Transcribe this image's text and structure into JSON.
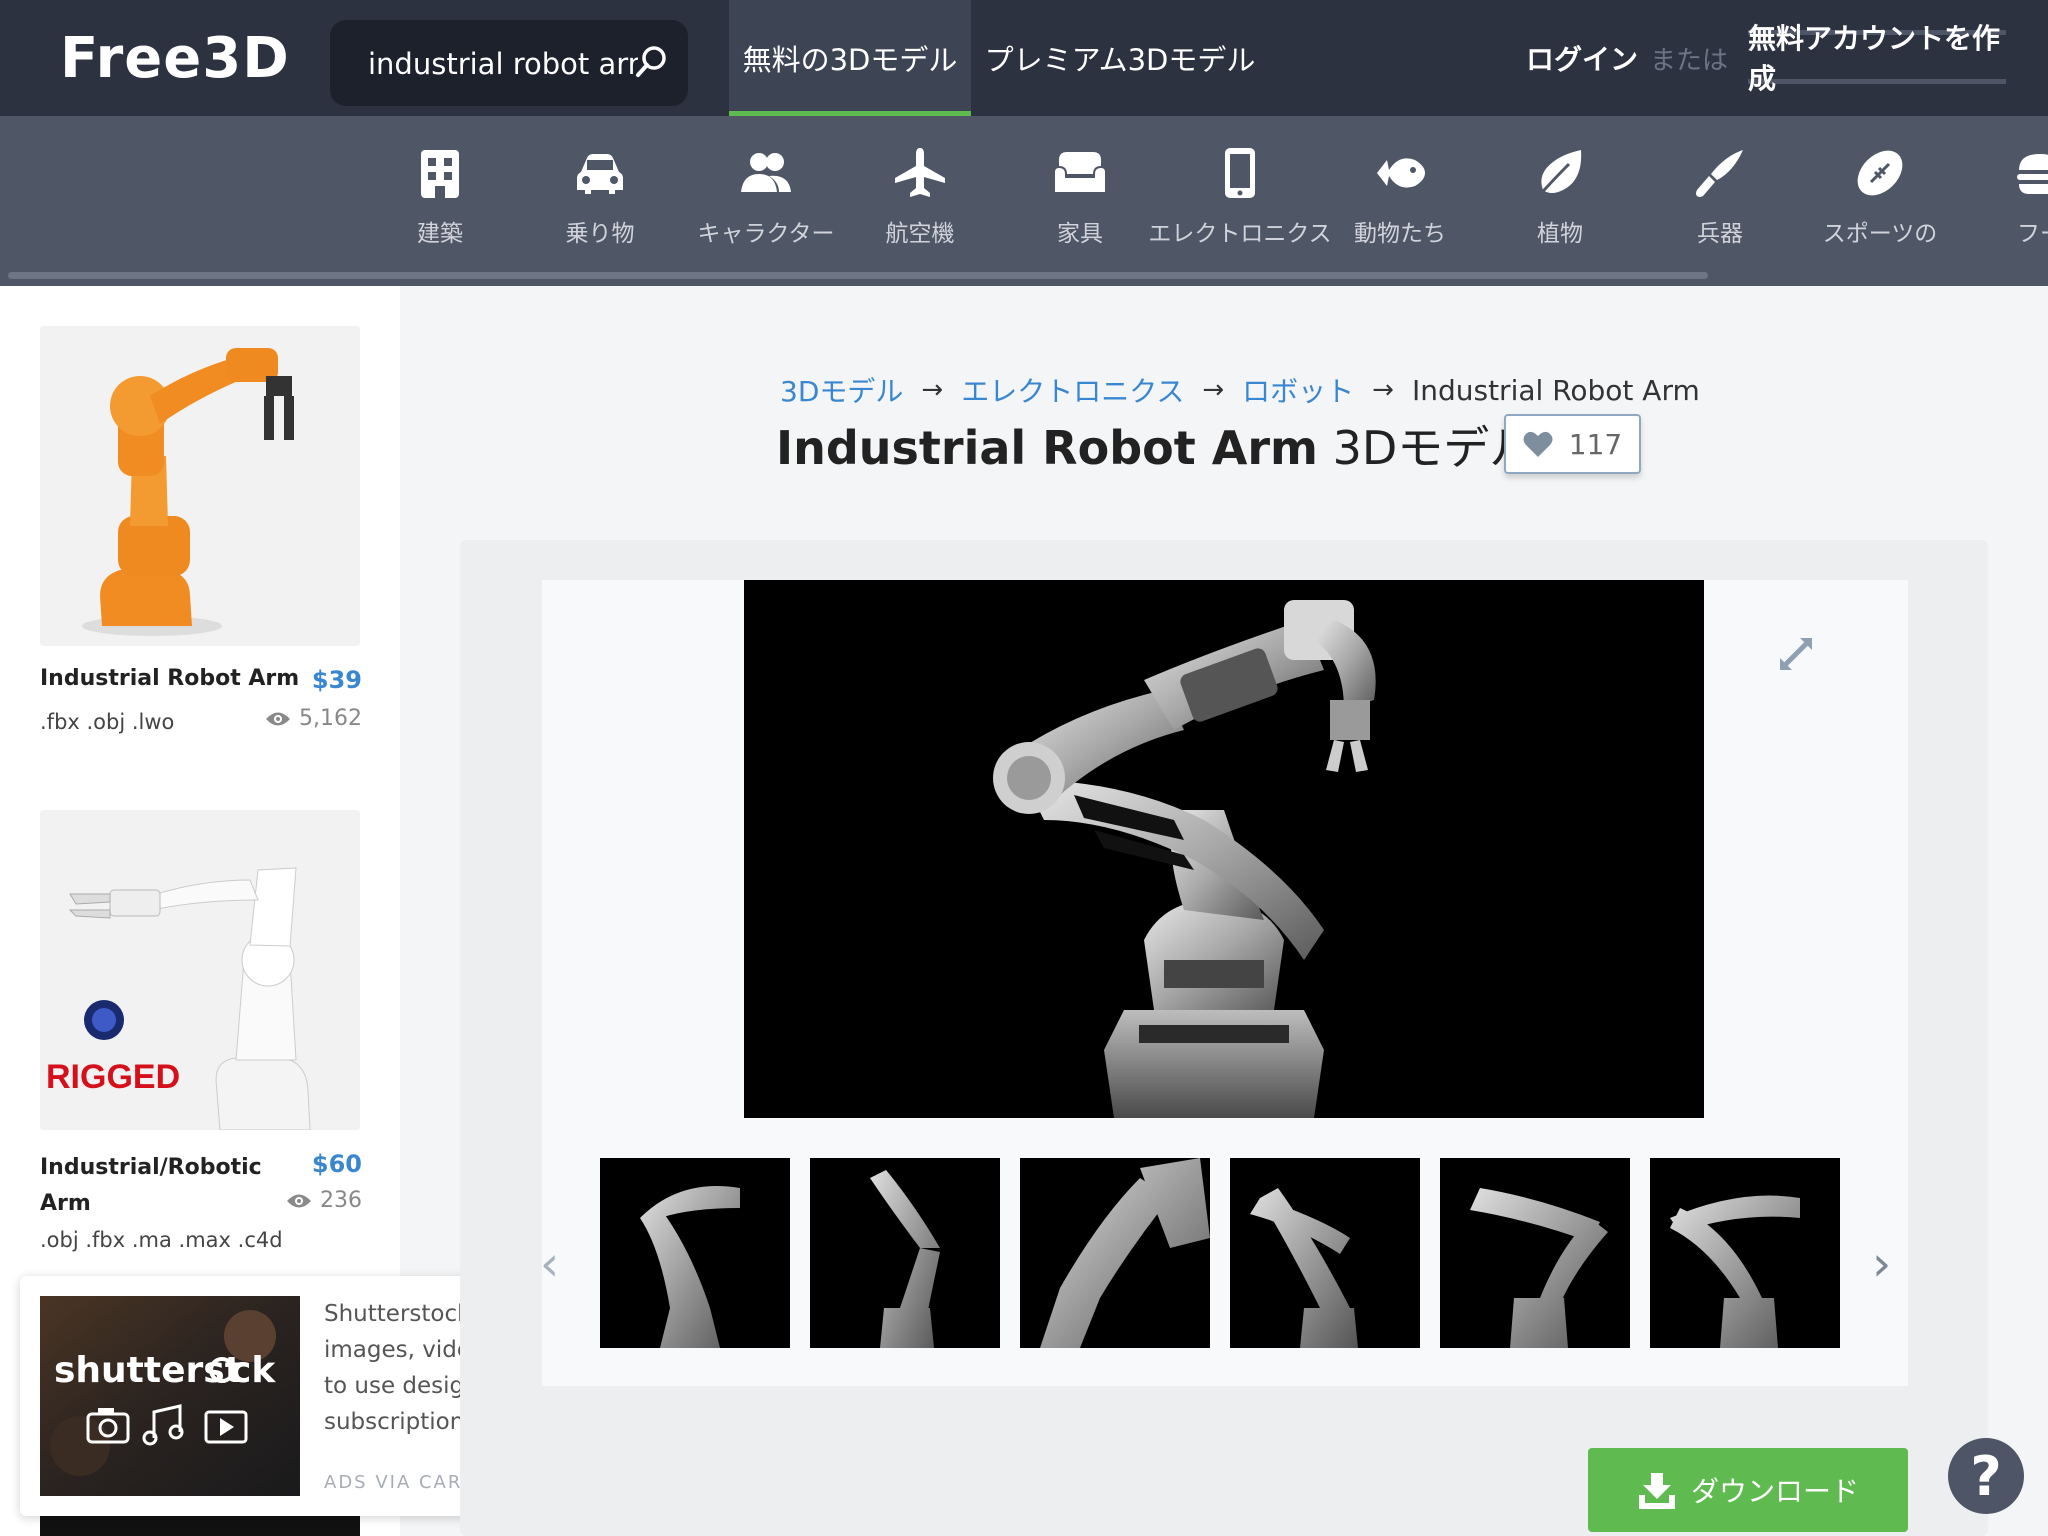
{
  "header": {
    "logo": "Free3D",
    "search_value": "industrial robot arm",
    "tabs": [
      {
        "label": "無料の3Dモデル",
        "active": true
      },
      {
        "label": "プレミアム3Dモデル",
        "active": false
      }
    ],
    "login": "ログイン",
    "or": "または",
    "signup": "無料アカウントを作成"
  },
  "categories": [
    {
      "label": "建築",
      "icon": "building-icon"
    },
    {
      "label": "乗り物",
      "icon": "car-icon"
    },
    {
      "label": "キャラクター",
      "icon": "people-icon"
    },
    {
      "label": "航空機",
      "icon": "airplane-icon"
    },
    {
      "label": "家具",
      "icon": "sofa-icon"
    },
    {
      "label": "エレクトロニクス",
      "icon": "phone-icon"
    },
    {
      "label": "動物たち",
      "icon": "fish-icon"
    },
    {
      "label": "植物",
      "icon": "leaf-icon"
    },
    {
      "label": "兵器",
      "icon": "knife-icon"
    },
    {
      "label": "スポーツの",
      "icon": "football-icon"
    },
    {
      "label": "フー",
      "icon": "food-icon"
    }
  ],
  "sidebar": {
    "items": [
      {
        "title": "Industrial Robot Arm",
        "price": "$39",
        "formats": ".fbx .obj .lwo",
        "views": "5,162"
      },
      {
        "title": "Industrial/Robotic Arm",
        "price": "$60",
        "formats": ".obj .fbx .ma .max .c4d",
        "views": "236",
        "badge": "RIGGED"
      }
    ]
  },
  "ad": {
    "brand": "shutterstock",
    "text": "Shutterstock Free Trial - Get images, video, music & easy to use design tools with one subscription.",
    "via": "ADS VIA CARBON"
  },
  "breadcrumb": {
    "items": [
      "3Dモデル",
      "エレクトロニクス",
      "ロボット"
    ],
    "current": "Industrial Robot Arm",
    "arrow": "→"
  },
  "model": {
    "title_bold": "Industrial Robot Arm",
    "title_suffix": "3Dモデル",
    "likes": "117"
  },
  "viewer": {
    "prev": "‹",
    "next": "›",
    "thumbnail_count": 6
  },
  "download_label": "ダウンロード",
  "help_label": "?",
  "colors": {
    "topbar": "#2d3240",
    "category_bar": "#4f5666",
    "accent_green": "#5fbb4f",
    "link_blue": "#3a87d1"
  }
}
